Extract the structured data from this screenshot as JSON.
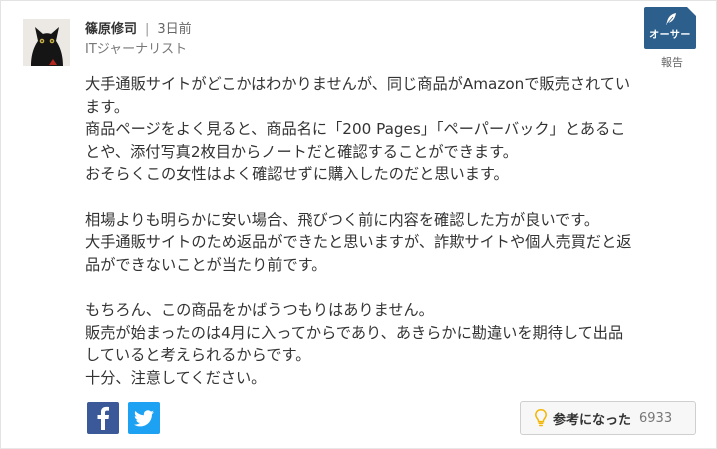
{
  "author": {
    "name": "篠原修司",
    "separator": "|",
    "timestamp": "3日前",
    "title": "ITジャーナリスト",
    "avatar_icon": "black-cat-avatar"
  },
  "badge": {
    "label": "オーサー",
    "color": "#2d5f8d",
    "icon": "feather-pen-icon"
  },
  "report_label": "報告",
  "comment": {
    "paragraphs": [
      {
        "lines": [
          "大手通販サイトがどこかはわかりませんが、同じ商品がAmazonで販売されてい",
          "ます。",
          "商品ページをよく見ると、商品名に「200 Pages」「ペーパーバック」とあるこ",
          "とや、添付写真2枚目からノートだと確認することができます。",
          "おそらくこの女性はよく確認せずに購入したのだと思います。"
        ]
      },
      {
        "lines": [
          "相場よりも明らかに安い場合、飛びつく前に内容を確認した方が良いです。",
          "大手通販サイトのため返品ができたと思いますが、詐欺サイトや個人売買だと返",
          "品ができないことが当たり前です。"
        ]
      },
      {
        "lines": [
          "もちろん、この商品をかばうつもりはありません。",
          "販売が始まったのは4月に入ってからであり、あきらかに勘違いを期待して出品",
          "していると考えられるからです。",
          "十分、注意してください。"
        ]
      }
    ]
  },
  "share": {
    "facebook_icon": "facebook-icon",
    "facebook_color": "#3b5998",
    "twitter_icon": "twitter-icon",
    "twitter_color": "#1da1f2"
  },
  "helpful": {
    "label": "参考になった",
    "count": "6933",
    "icon": "lightbulb-icon",
    "icon_color": "#f2b705"
  }
}
